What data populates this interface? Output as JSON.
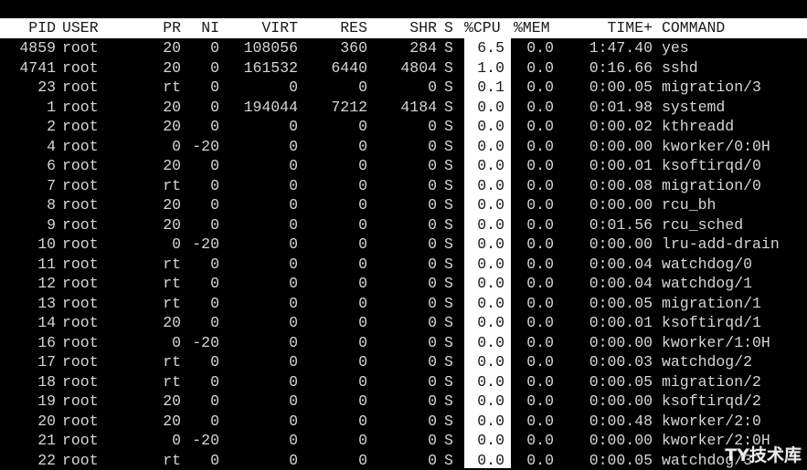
{
  "colors": {
    "background": "#000000",
    "text": "#d6d6d6",
    "header_bg": "#ffffff",
    "cpu_column_bg": "#ffffff"
  },
  "columns": {
    "pid": "PID",
    "user": "USER",
    "pr": "PR",
    "ni": "NI",
    "virt": "VIRT",
    "res": "RES",
    "shr": "SHR",
    "s": "S",
    "cpu": "%CPU",
    "mem": "%MEM",
    "time": "TIME+",
    "command": "COMMAND"
  },
  "processes": [
    {
      "pid": "4859",
      "user": "root",
      "pr": "20",
      "ni": "0",
      "virt": "108056",
      "res": "360",
      "shr": "284",
      "s": "S",
      "cpu": "6.5",
      "mem": "0.0",
      "time": "1:47.40",
      "command": "yes"
    },
    {
      "pid": "4741",
      "user": "root",
      "pr": "20",
      "ni": "0",
      "virt": "161532",
      "res": "6440",
      "shr": "4804",
      "s": "S",
      "cpu": "1.0",
      "mem": "0.0",
      "time": "0:16.66",
      "command": "sshd"
    },
    {
      "pid": "23",
      "user": "root",
      "pr": "rt",
      "ni": "0",
      "virt": "0",
      "res": "0",
      "shr": "0",
      "s": "S",
      "cpu": "0.1",
      "mem": "0.0",
      "time": "0:00.05",
      "command": "migration/3"
    },
    {
      "pid": "1",
      "user": "root",
      "pr": "20",
      "ni": "0",
      "virt": "194044",
      "res": "7212",
      "shr": "4184",
      "s": "S",
      "cpu": "0.0",
      "mem": "0.0",
      "time": "0:01.98",
      "command": "systemd"
    },
    {
      "pid": "2",
      "user": "root",
      "pr": "20",
      "ni": "0",
      "virt": "0",
      "res": "0",
      "shr": "0",
      "s": "S",
      "cpu": "0.0",
      "mem": "0.0",
      "time": "0:00.02",
      "command": "kthreadd"
    },
    {
      "pid": "4",
      "user": "root",
      "pr": "0",
      "ni": "-20",
      "virt": "0",
      "res": "0",
      "shr": "0",
      "s": "S",
      "cpu": "0.0",
      "mem": "0.0",
      "time": "0:00.00",
      "command": "kworker/0:0H"
    },
    {
      "pid": "6",
      "user": "root",
      "pr": "20",
      "ni": "0",
      "virt": "0",
      "res": "0",
      "shr": "0",
      "s": "S",
      "cpu": "0.0",
      "mem": "0.0",
      "time": "0:00.01",
      "command": "ksoftirqd/0"
    },
    {
      "pid": "7",
      "user": "root",
      "pr": "rt",
      "ni": "0",
      "virt": "0",
      "res": "0",
      "shr": "0",
      "s": "S",
      "cpu": "0.0",
      "mem": "0.0",
      "time": "0:00.08",
      "command": "migration/0"
    },
    {
      "pid": "8",
      "user": "root",
      "pr": "20",
      "ni": "0",
      "virt": "0",
      "res": "0",
      "shr": "0",
      "s": "S",
      "cpu": "0.0",
      "mem": "0.0",
      "time": "0:00.00",
      "command": "rcu_bh"
    },
    {
      "pid": "9",
      "user": "root",
      "pr": "20",
      "ni": "0",
      "virt": "0",
      "res": "0",
      "shr": "0",
      "s": "S",
      "cpu": "0.0",
      "mem": "0.0",
      "time": "0:01.56",
      "command": "rcu_sched"
    },
    {
      "pid": "10",
      "user": "root",
      "pr": "0",
      "ni": "-20",
      "virt": "0",
      "res": "0",
      "shr": "0",
      "s": "S",
      "cpu": "0.0",
      "mem": "0.0",
      "time": "0:00.00",
      "command": "lru-add-drain"
    },
    {
      "pid": "11",
      "user": "root",
      "pr": "rt",
      "ni": "0",
      "virt": "0",
      "res": "0",
      "shr": "0",
      "s": "S",
      "cpu": "0.0",
      "mem": "0.0",
      "time": "0:00.04",
      "command": "watchdog/0"
    },
    {
      "pid": "12",
      "user": "root",
      "pr": "rt",
      "ni": "0",
      "virt": "0",
      "res": "0",
      "shr": "0",
      "s": "S",
      "cpu": "0.0",
      "mem": "0.0",
      "time": "0:00.04",
      "command": "watchdog/1"
    },
    {
      "pid": "13",
      "user": "root",
      "pr": "rt",
      "ni": "0",
      "virt": "0",
      "res": "0",
      "shr": "0",
      "s": "S",
      "cpu": "0.0",
      "mem": "0.0",
      "time": "0:00.05",
      "command": "migration/1"
    },
    {
      "pid": "14",
      "user": "root",
      "pr": "20",
      "ni": "0",
      "virt": "0",
      "res": "0",
      "shr": "0",
      "s": "S",
      "cpu": "0.0",
      "mem": "0.0",
      "time": "0:00.01",
      "command": "ksoftirqd/1"
    },
    {
      "pid": "16",
      "user": "root",
      "pr": "0",
      "ni": "-20",
      "virt": "0",
      "res": "0",
      "shr": "0",
      "s": "S",
      "cpu": "0.0",
      "mem": "0.0",
      "time": "0:00.00",
      "command": "kworker/1:0H"
    },
    {
      "pid": "17",
      "user": "root",
      "pr": "rt",
      "ni": "0",
      "virt": "0",
      "res": "0",
      "shr": "0",
      "s": "S",
      "cpu": "0.0",
      "mem": "0.0",
      "time": "0:00.03",
      "command": "watchdog/2"
    },
    {
      "pid": "18",
      "user": "root",
      "pr": "rt",
      "ni": "0",
      "virt": "0",
      "res": "0",
      "shr": "0",
      "s": "S",
      "cpu": "0.0",
      "mem": "0.0",
      "time": "0:00.05",
      "command": "migration/2"
    },
    {
      "pid": "19",
      "user": "root",
      "pr": "20",
      "ni": "0",
      "virt": "0",
      "res": "0",
      "shr": "0",
      "s": "S",
      "cpu": "0.0",
      "mem": "0.0",
      "time": "0:00.00",
      "command": "ksoftirqd/2"
    },
    {
      "pid": "20",
      "user": "root",
      "pr": "20",
      "ni": "0",
      "virt": "0",
      "res": "0",
      "shr": "0",
      "s": "S",
      "cpu": "0.0",
      "mem": "0.0",
      "time": "0:00.48",
      "command": "kworker/2:0"
    },
    {
      "pid": "21",
      "user": "root",
      "pr": "0",
      "ni": "-20",
      "virt": "0",
      "res": "0",
      "shr": "0",
      "s": "S",
      "cpu": "0.0",
      "mem": "0.0",
      "time": "0:00.00",
      "command": "kworker/2:0H"
    },
    {
      "pid": "22",
      "user": "root",
      "pr": "rt",
      "ni": "0",
      "virt": "0",
      "res": "0",
      "shr": "0",
      "s": "S",
      "cpu": "0.0",
      "mem": "0.0",
      "time": "0:00.05",
      "command": "watchdog/3"
    }
  ],
  "watermark": "TY技术库"
}
